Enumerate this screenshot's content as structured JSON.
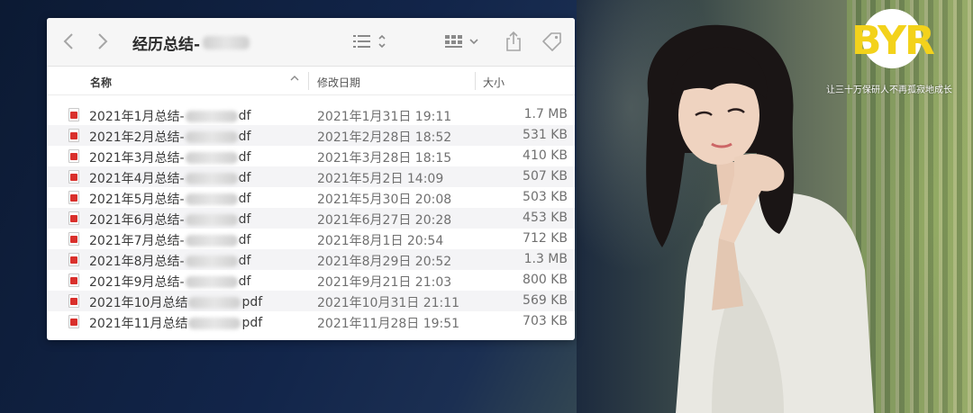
{
  "window": {
    "title": "经历总结-",
    "columns": {
      "name": "名称",
      "date": "修改日期",
      "size": "大小"
    },
    "files": [
      {
        "name_prefix": "2021年1月总结-",
        "name_suffix": "df",
        "date": "2021年1月31日 19:11",
        "size": "1.7 MB"
      },
      {
        "name_prefix": "2021年2月总结-",
        "name_suffix": "df",
        "date": "2021年2月28日 18:52",
        "size": "531 KB"
      },
      {
        "name_prefix": "2021年3月总结-",
        "name_suffix": "df",
        "date": "2021年3月28日 18:15",
        "size": "410 KB"
      },
      {
        "name_prefix": "2021年4月总结-",
        "name_suffix": "df",
        "date": "2021年5月2日 14:09",
        "size": "507 KB"
      },
      {
        "name_prefix": "2021年5月总结-",
        "name_suffix": "df",
        "date": "2021年5月30日 20:08",
        "size": "503 KB"
      },
      {
        "name_prefix": "2021年6月总结-",
        "name_suffix": "df",
        "date": "2021年6月27日 20:28",
        "size": "453 KB"
      },
      {
        "name_prefix": "2021年7月总结-",
        "name_suffix": "df",
        "date": "2021年8月1日 20:54",
        "size": "712 KB"
      },
      {
        "name_prefix": "2021年8月总结-",
        "name_suffix": "df",
        "date": "2021年8月29日 20:52",
        "size": "1.3 MB"
      },
      {
        "name_prefix": "2021年9月总结-",
        "name_suffix": "df",
        "date": "2021年9月21日 21:03",
        "size": "800 KB"
      },
      {
        "name_prefix": "2021年10月总结",
        "name_suffix": "pdf",
        "date": "2021年10月31日 21:11",
        "size": "569 KB"
      },
      {
        "name_prefix": "2021年11月总结",
        "name_suffix": "pdf",
        "date": "2021年11月28日 19:51",
        "size": "703 KB"
      }
    ]
  },
  "icons": {
    "back": "chevron-left-icon",
    "forward": "chevron-right-icon",
    "list_view": "list-view-icon",
    "grid_view": "grid-view-icon",
    "share": "share-icon",
    "tag": "tag-icon",
    "file": "pdf-file-icon"
  },
  "brand": {
    "logo": "BYR",
    "slogan": "让三十万保研人不再孤寂地成长",
    "accent": "#f3d21b"
  }
}
